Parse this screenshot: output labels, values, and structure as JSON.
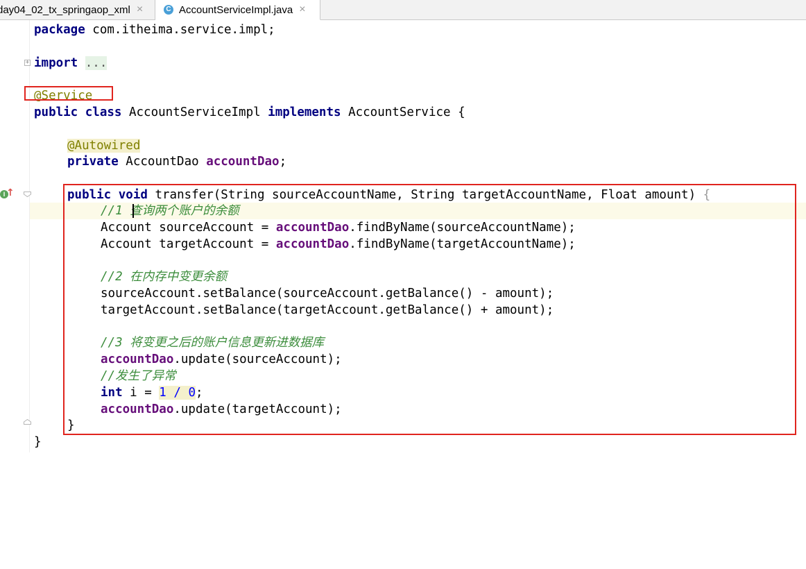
{
  "tabs": [
    {
      "label": "day04_02_tx_springaop_xml",
      "close": "×",
      "active": false
    },
    {
      "label": "AccountServiceImpl.java",
      "close": "×",
      "active": true,
      "icon": "C"
    }
  ],
  "gutter": {
    "fold_import": "+",
    "impl_marker": "I",
    "impl_arrow": "↑"
  },
  "code": {
    "package_kw": "package",
    "package_name": " com.itheima.service.impl;",
    "import_kw": "import",
    "import_dots": "...",
    "service_annotation": "@Service",
    "class_public": "public",
    "class_kw": "class",
    "class_name": " AccountServiceImpl ",
    "implements_kw": "implements",
    "interface_name": " AccountService {",
    "autowired": "@Autowired",
    "private_kw": "private",
    "dao_type": " AccountDao ",
    "dao_field": "accountDao",
    "semicolon": ";",
    "method_public": "public",
    "method_void": "void",
    "method_sig": " transfer(String sourceAccountName, String targetAccountName, Float amount) ",
    "method_brace": "{",
    "c1": "//1 查询两个账户的余额",
    "l_src_pre": "Account sourceAccount = ",
    "l_src_post": ".findByName(sourceAccountName);",
    "l_tgt_pre": "Account targetAccount = ",
    "l_tgt_post": ".findByName(targetAccountName);",
    "c2": "//2 在内存中变更余额",
    "l_set_src": "sourceAccount.setBalance(sourceAccount.getBalance() - amount);",
    "l_set_tgt": "targetAccount.setBalance(targetAccount.getBalance() + amount);",
    "c3": "//3 将变更之后的账户信息更新进数据库",
    "l_upd_src": ".update(sourceAccount);",
    "c4": "//发生了异常",
    "int_kw": "int",
    "int_var": " i = ",
    "int_one": "1",
    "int_div": " / ",
    "int_zero": "0",
    "l_upd_tgt": ".update(targetAccount);",
    "close_method": "}",
    "close_class": "}"
  },
  "colors": {
    "keyword": "#000080",
    "annotation": "#808000",
    "field": "#660e7a",
    "comment": "#3c8d3c",
    "number": "#0000ff",
    "highlight_box": "#e0241e",
    "current_line": "#fcfae8"
  }
}
